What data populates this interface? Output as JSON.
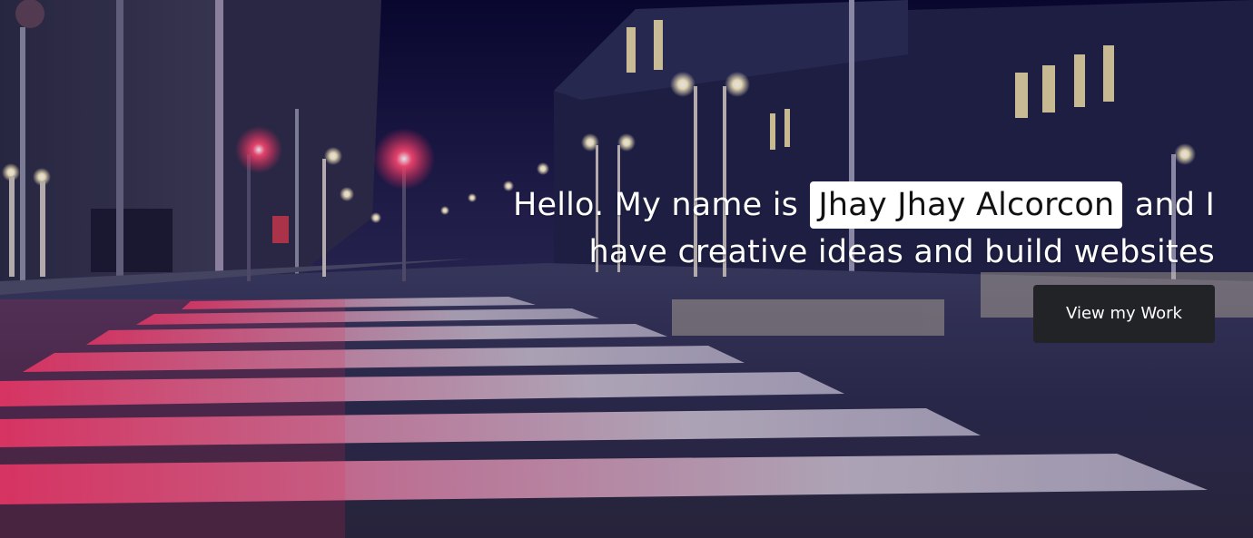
{
  "hero": {
    "title_before": "Hello. My name is",
    "name": "Jhay Jhay Alcorcon",
    "title_after": "and I have creative ideas and build websites",
    "cta_label": "View my Work"
  },
  "background": {
    "description_icon": "night-street-crosswalk-image",
    "colors": {
      "sky": "#07062a",
      "asphalt": "#3a3a5a",
      "crosswalk_stripe": "#d8c8d0",
      "red_glow": "#ff2a55",
      "street_light": "#fff2c0"
    }
  },
  "colors": {
    "button_bg": "#222326",
    "button_text": "#ffffff",
    "name_highlight": "#ffffff"
  }
}
